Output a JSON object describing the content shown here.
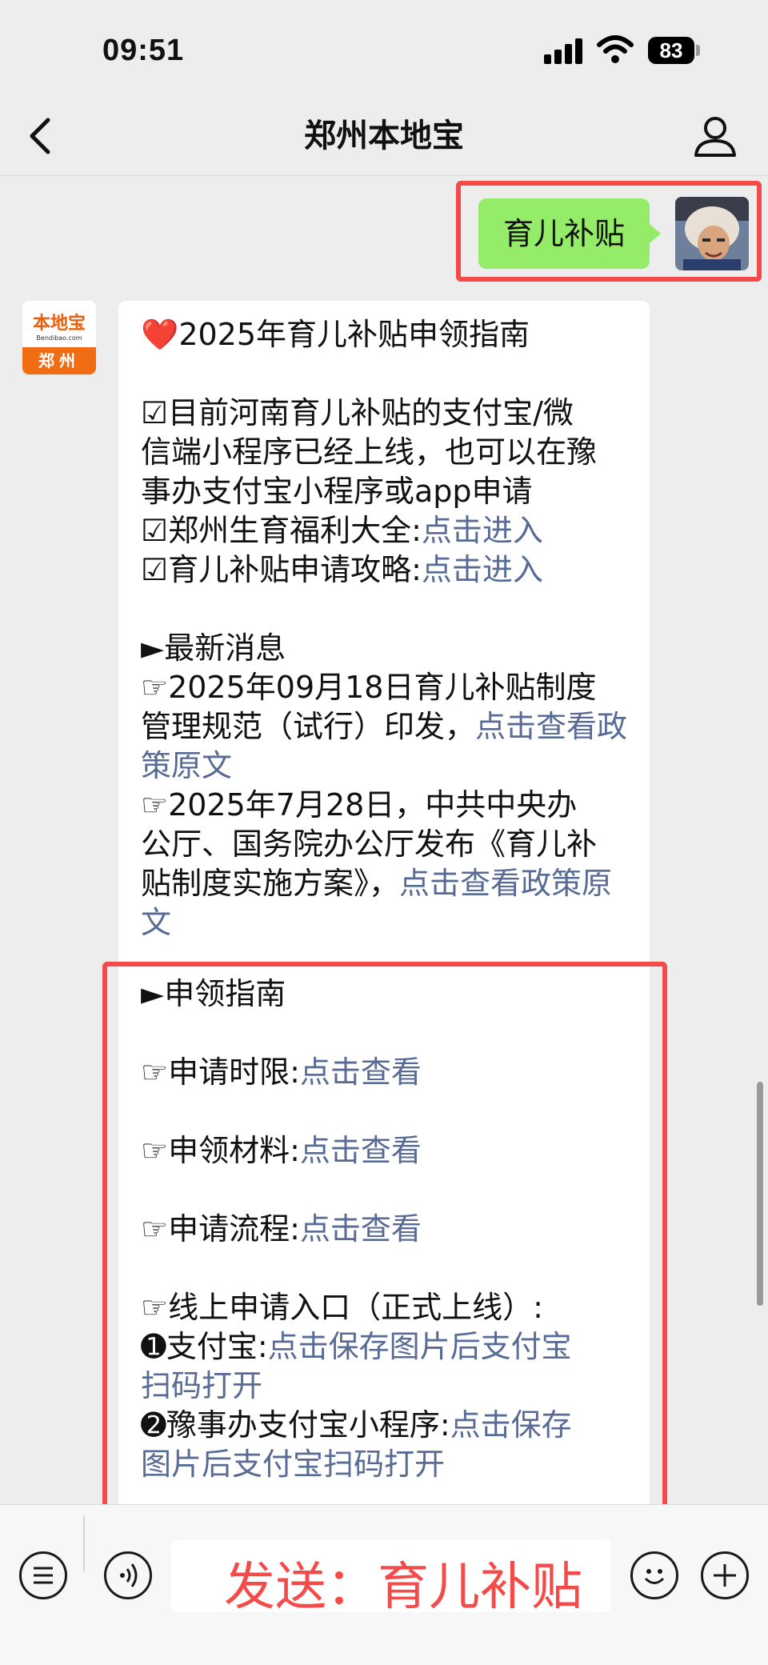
{
  "status_bar": {
    "time": "09:51",
    "battery": "83"
  },
  "nav": {
    "title": "郑州本地宝"
  },
  "sent_message": {
    "text": "育儿补贴"
  },
  "bot": {
    "logo_text": "本地宝",
    "logo_sub": "Bendibao.com",
    "logo_city": "郑州"
  },
  "message": {
    "title_heart": "❤️",
    "title": "2025年育儿补贴申领指南",
    "intro_1": "☑目前河南育儿补贴的支付宝/微",
    "intro_2": "信端小程序已经上线，也可以在豫",
    "intro_3": "事办支付宝小程序或app申请",
    "welfare_label": "☑郑州生育福利大全:",
    "welfare_link": "点击进入",
    "strategy_label": "☑育儿补贴申请攻略:",
    "strategy_link": "点击进入",
    "news_heading": "►最新消息",
    "news1_1": "☞2025年09月18日育儿补贴制度",
    "news1_2_text": "管理规范（试行）印发，",
    "news1_2_link": "点击查看政",
    "news1_3_link": "策原文",
    "news2_1": "☞2025年7月28日，中共中央办",
    "news2_2": "公厅、国务院办公厅发布《育儿补",
    "news2_3_text": "贴制度实施方案》，",
    "news2_3_link": "点击查看政策原",
    "news2_4_link": "文",
    "guide_heading": "►申领指南",
    "item1_label": "☞申请时限:",
    "item1_link": "点击查看",
    "item2_label": "☞申领材料:",
    "item2_link": "点击查看",
    "item3_label": "☞申请流程:",
    "item3_link": "点击查看",
    "online_heading": "☞线上申请入口（正式上线）:",
    "entry1_label": "➊支付宝:",
    "entry1_link_1": "点击保存图片后支付宝",
    "entry1_link_2": "扫码打开",
    "entry2_label": "➋豫事办支付宝小程序:",
    "entry2_link_1": "点击保存",
    "entry2_link_2": "图片后支付宝扫码打开"
  },
  "overlay": {
    "text": "发送：育儿补贴"
  },
  "colors": {
    "link": "#576b95",
    "sent_bubble": "#95ec69",
    "highlight": "#f44a4a",
    "logo_orange": "#f06d13"
  }
}
